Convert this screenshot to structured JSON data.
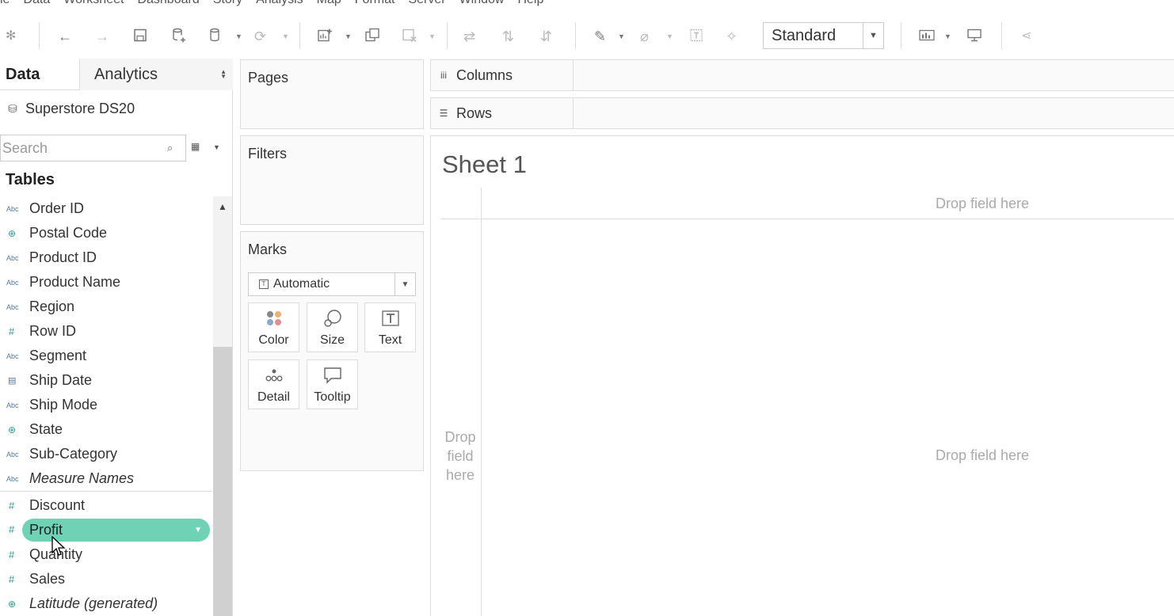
{
  "menubar": [
    "le",
    "Data",
    "Worksheet",
    "Dashboard",
    "Story",
    "Analysis",
    "Map",
    "Format",
    "Server",
    "Window",
    "Help"
  ],
  "toolbar": {
    "view_mode": "Standard"
  },
  "data_pane": {
    "tabs": {
      "data": "Data",
      "analytics": "Analytics"
    },
    "datasource": "Superstore DS20",
    "search": {
      "placeholder": "Search",
      "value": ""
    },
    "tables_heading": "Tables",
    "fields": [
      {
        "type": "Abc",
        "name": "Order ID"
      },
      {
        "type": "geo",
        "name": "Postal Code"
      },
      {
        "type": "Abc",
        "name": "Product ID"
      },
      {
        "type": "Abc",
        "name": "Product Name"
      },
      {
        "type": "Abc",
        "name": "Region"
      },
      {
        "type": "#",
        "name": "Row ID"
      },
      {
        "type": "Abc",
        "name": "Segment"
      },
      {
        "type": "date",
        "name": "Ship Date"
      },
      {
        "type": "Abc",
        "name": "Ship Mode"
      },
      {
        "type": "geo",
        "name": "State"
      },
      {
        "type": "Abc",
        "name": "Sub-Category"
      },
      {
        "type": "Abc",
        "name": "Measure Names"
      }
    ],
    "measures": [
      {
        "type": "#",
        "name": "Discount"
      },
      {
        "type": "#",
        "name": "Profit"
      },
      {
        "type": "#",
        "name": "Quantity"
      },
      {
        "type": "#",
        "name": "Sales"
      },
      {
        "type": "geo",
        "name": "Latitude (generated)"
      }
    ]
  },
  "cards": {
    "pages": "Pages",
    "filters": "Filters",
    "marks": {
      "title": "Marks",
      "mark_type": "Automatic",
      "buttons": [
        "Color",
        "Size",
        "Text",
        "Detail",
        "Tooltip"
      ]
    }
  },
  "shelves": {
    "columns": "Columns",
    "rows": "Rows"
  },
  "viz": {
    "sheet_title": "Sheet 1",
    "drop_top": "Drop field here",
    "drop_center": "Drop field here",
    "drop_left": [
      "Drop",
      "field",
      "here"
    ]
  }
}
